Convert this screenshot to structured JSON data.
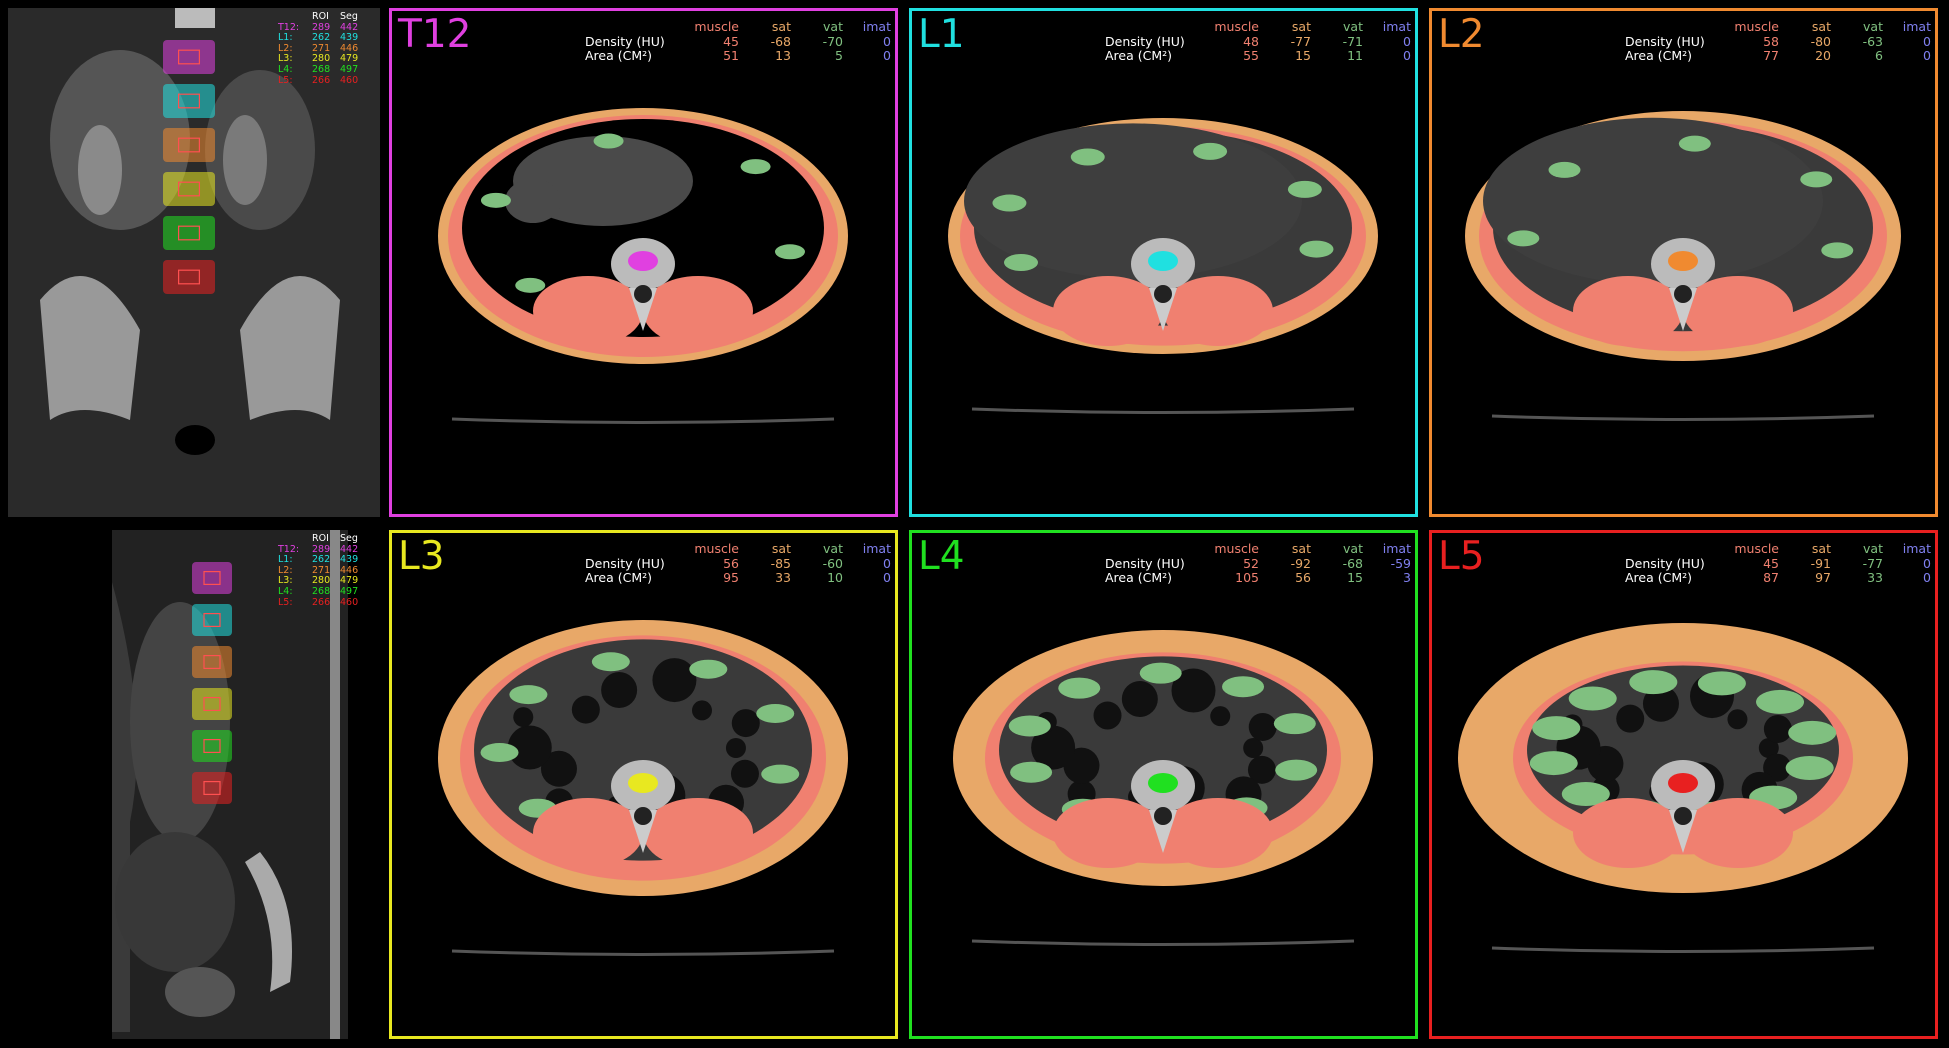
{
  "sidebar_table": {
    "header": [
      "ROI",
      "Seg"
    ],
    "rows": [
      {
        "label": "T12:",
        "roi": "289",
        "seg": "442",
        "color": "#e040e0"
      },
      {
        "label": "L1:",
        "roi": "262",
        "seg": "439",
        "color": "#20e0e0"
      },
      {
        "label": "L2:",
        "roi": "271",
        "seg": "446",
        "color": "#f08a30"
      },
      {
        "label": "L3:",
        "roi": "280",
        "seg": "479",
        "color": "#e8e820"
      },
      {
        "label": "L4:",
        "roi": "268",
        "seg": "497",
        "color": "#20e020"
      },
      {
        "label": "L5:",
        "roi": "266",
        "seg": "460",
        "color": "#e82020"
      }
    ]
  },
  "stats_labels": {
    "columns": [
      "muscle",
      "sat",
      "vat",
      "imat"
    ],
    "density": "Density (HU)",
    "area": "Area (CM²)"
  },
  "colors": {
    "muscle": "#f08070",
    "sat": "#e8a868",
    "vat": "#80c080",
    "imat": "#8080f0"
  },
  "panels": [
    {
      "id": "T12",
      "label": "T12",
      "color": "#e040e0",
      "density": [
        "45",
        "-68",
        "-70",
        "0"
      ],
      "area": [
        "51",
        "13",
        "5",
        "0"
      ]
    },
    {
      "id": "L1",
      "label": "L1",
      "color": "#20e0e0",
      "density": [
        "48",
        "-77",
        "-71",
        "0"
      ],
      "area": [
        "55",
        "15",
        "11",
        "0"
      ]
    },
    {
      "id": "L2",
      "label": "L2",
      "color": "#f08a30",
      "density": [
        "58",
        "-80",
        "-63",
        "0"
      ],
      "area": [
        "77",
        "20",
        "6",
        "0"
      ]
    },
    {
      "id": "L3",
      "label": "L3",
      "color": "#e8e820",
      "density": [
        "56",
        "-85",
        "-60",
        "0"
      ],
      "area": [
        "95",
        "33",
        "10",
        "0"
      ]
    },
    {
      "id": "L4",
      "label": "L4",
      "color": "#20e020",
      "density": [
        "52",
        "-92",
        "-68",
        "-59"
      ],
      "area": [
        "105",
        "56",
        "15",
        "3"
      ]
    },
    {
      "id": "L5",
      "label": "L5",
      "color": "#e82020",
      "density": [
        "45",
        "-91",
        "-77",
        "0"
      ],
      "area": [
        "87",
        "97",
        "33",
        "0"
      ]
    }
  ]
}
